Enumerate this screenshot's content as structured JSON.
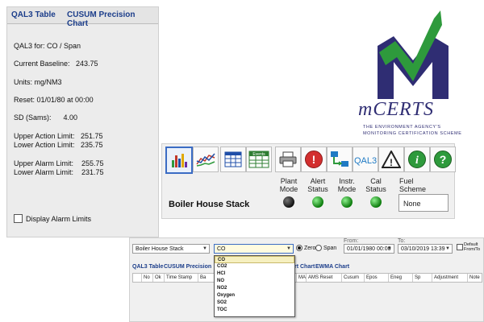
{
  "qal3_panel": {
    "tabs": [
      "QAL3 Table",
      "CUSUM Precision Chart"
    ],
    "for_label": "QAL3 for: CO / Span",
    "current_baseline": "Current Baseline:   243.75",
    "units": "Units: mg/NM3",
    "reset": "Reset: 01/01/80 at 00:00",
    "sd": "SD (Sams):      4.00",
    "upper_action": "Upper Action Limit:   251.75",
    "lower_action": "Lower Action Limit:   235.75",
    "upper_alarm": "Upper Alarm Limit:    255.75",
    "lower_alarm": "Lower Alarm Limit:    231.75",
    "display_alarm_limits": "Display Alarm Limits"
  },
  "logo": {
    "brand": "mCERTS",
    "tagline_1": "THE ENVIRONMENT AGENCY'S",
    "tagline_2": "MONITORING CERTIFICATION SCHEME",
    "colors": {
      "green": "#2e9a3c",
      "navy": "#2f2d73"
    }
  },
  "toolbar": {
    "buttons": [
      {
        "icon": "bar-chart-icon"
      },
      {
        "icon": "line-chart-icon"
      },
      {
        "icon": "table-icon"
      },
      {
        "icon": "events-icon",
        "label": "Events"
      },
      {
        "icon": "printer-icon"
      },
      {
        "icon": "alert-icon",
        "label": "!"
      },
      {
        "icon": "network-icon"
      },
      {
        "icon": "qal3-icon",
        "label": "QAL3"
      },
      {
        "icon": "warning-icon",
        "label": "!"
      },
      {
        "icon": "info-icon",
        "label": "i"
      },
      {
        "icon": "help-icon",
        "label": "?"
      }
    ],
    "stack_name": "Boiler House Stack",
    "statuses": [
      {
        "label": "Plant\nMode",
        "state": "off"
      },
      {
        "label": "Alert\nStatus",
        "state": "on"
      },
      {
        "label": "Instr.\nMode",
        "state": "on"
      },
      {
        "label": "Cal\nStatus",
        "state": "on"
      }
    ],
    "fuel_label": "Fuel\nScheme",
    "fuel_value": "None"
  },
  "grid_panel": {
    "stack_select": "Boiler House Stack",
    "pollutant_select": "CO",
    "zero_label": "Zero",
    "span_label": "Span",
    "from_label": "From:",
    "from_value": "01/01/1980 00:00",
    "to_label": "To:",
    "to_value": "03/10/2019 13:39",
    "default_label_1": "Default",
    "default_label_2": "From/To",
    "tabs": [
      "QAL3 Table",
      "CUSUM Precision",
      "rt Chart",
      "EWMA Chart"
    ],
    "columns": [
      "No",
      "Ok",
      "Time Stamp",
      "Ba",
      "MA",
      "AMS Reset",
      "Cusum",
      "Epos",
      "Eneg",
      "Sp",
      "Adjustment",
      "Note"
    ],
    "dropdown_options": [
      "CO",
      "CO2",
      "HCl",
      "NO",
      "NO2",
      "Oxygen",
      "SO2",
      "TOC"
    ],
    "selected_option": "CO"
  }
}
